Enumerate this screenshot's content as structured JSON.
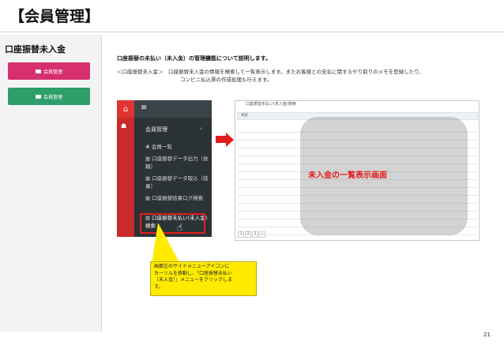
{
  "title": "【会員管理】",
  "left": {
    "heading": "口座振替未入金",
    "buttons": [
      {
        "label": "会員管理",
        "color": "#d6306f"
      },
      {
        "label": "会員管理",
        "color": "#2e9e6a"
      }
    ]
  },
  "description": {
    "heading": "口座振替の未払い（未入金）の管理機能について説明します。",
    "line1": "＜口座振替未入金＞　口座振替未入金の情報を検索して一覧表示します。またお客様との支払に関するやり取りのメモを登録したり、",
    "line2": "コンビニ払込票の作成処理も行えます。"
  },
  "sidebar": {
    "group": "会員管理",
    "items": [
      {
        "bullet": "♣",
        "label": "会員一覧"
      },
      {
        "bullet": "▦",
        "label": "口座振替データ出力（依頼）"
      },
      {
        "bullet": "▦",
        "label": "口座振替データ取込（結果）"
      },
      {
        "bullet": "▦",
        "label": "口座振替結果ログ検索"
      },
      {
        "bullet": "▦",
        "label": "口座振替未払い(未入金)検索"
      }
    ]
  },
  "screenshot": {
    "title": "口座振替未払い(未入金)検索",
    "search_label": "検索",
    "overlay_label": "未入金の一覧表示画面",
    "pages": [
      "1",
      "2",
      "3",
      "»"
    ]
  },
  "callout": {
    "lines": [
      "画面左のサイドメニューアイコンに",
      "カーソルを移動し、「口座振替未払い",
      "（未入金）」メニューをクリックしま",
      "す。"
    ]
  },
  "page_number": "21",
  "accent_colors": {
    "red": "#e31d1d",
    "yellow": "#ffeb00"
  }
}
